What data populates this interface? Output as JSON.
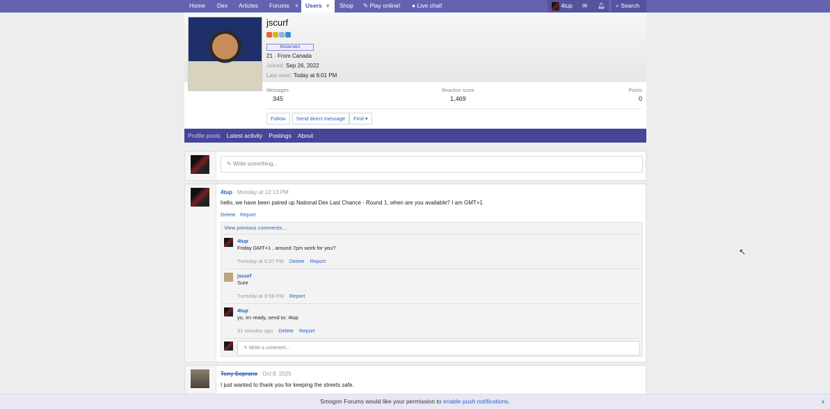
{
  "nav": {
    "home": "Home",
    "dex": "Dex",
    "articles": "Articles",
    "forums": "Forums",
    "users": "Users",
    "shop": "Shop",
    "play": "Play online!",
    "chat": "Live chat!",
    "user": "4tup",
    "search": "Search"
  },
  "profile": {
    "username": "jscurf",
    "role": "Moderator",
    "age_location": "21 · From Canada",
    "joined_label": "Joined:",
    "joined": "Sep 26, 2022",
    "seen_label": "Last seen:",
    "seen": "Today at 6:01 PM",
    "stats": [
      {
        "label": "Messages",
        "value": "345"
      },
      {
        "label": "Reaction score",
        "value": "1,469"
      },
      {
        "label": "Points",
        "value": "0"
      }
    ],
    "buttons": {
      "follow": "Follow",
      "message": "Send direct message",
      "find": "Find ▾"
    }
  },
  "tabs": [
    "Profile posts",
    "Latest activity",
    "Postings",
    "About"
  ],
  "compose": {
    "placeholder": "Write something..."
  },
  "post": {
    "author": "4tup",
    "time": "Monday at 12:13 PM",
    "text": "hello, we have been paired up National Dex Last Chance - Round 1, when are you available? I am GMT+1",
    "delete": "Delete",
    "report": "Report",
    "view_previous": "View previous comments...",
    "comments": [
      {
        "author": "4tup",
        "text": "Friday GMT+1 , around 7pm work for you?",
        "time": "Tuesday at 6:37 PM",
        "actions": [
          "Delete",
          "Report"
        ]
      },
      {
        "author": "jscurf",
        "text": "Sure",
        "time": "Tuesday at 9:58 PM",
        "actions": [
          "Report"
        ]
      },
      {
        "author": "4tup",
        "text": "yo, im ready, send to: 4tup",
        "time": "31 minutes ago",
        "actions": [
          "Delete",
          "Report"
        ]
      }
    ],
    "comment_placeholder": "Write a comment..."
  },
  "post2": {
    "author": "Tony Soprano",
    "time": "Oct 8, 2025",
    "text": "I just wanted to thank you for keeping the streets safe."
  },
  "push": {
    "text": "Smogon Forums would like your permission to ",
    "link": "enable push notifications",
    "end": ".",
    "close": "x"
  }
}
